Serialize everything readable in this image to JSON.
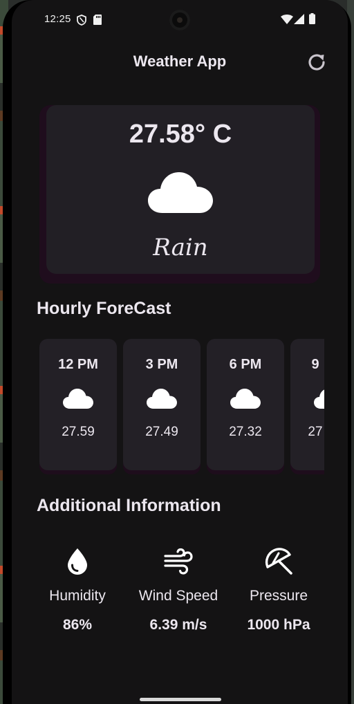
{
  "status_bar": {
    "time": "12:25",
    "icons": [
      "shield-icon",
      "sd-card-icon",
      "wifi-icon",
      "signal-icon",
      "battery-icon"
    ]
  },
  "app": {
    "title": "Weather App",
    "refresh_icon": "refresh-icon"
  },
  "current": {
    "temperature": "27.58° C",
    "condition": "Rain",
    "icon": "cloud-icon"
  },
  "hourly": {
    "heading": "Hourly ForeCast",
    "items": [
      {
        "time": "12 PM",
        "temp": "27.59",
        "icon": "cloud-icon"
      },
      {
        "time": "3 PM",
        "temp": "27.49",
        "icon": "cloud-icon"
      },
      {
        "time": "6 PM",
        "temp": "27.32",
        "icon": "cloud-icon"
      },
      {
        "time": "9",
        "temp": "27",
        "icon": "cloud-icon"
      }
    ]
  },
  "additional": {
    "heading": "Additional Information",
    "items": [
      {
        "label": "Humidity",
        "value": "86%",
        "icon": "water-drop-icon"
      },
      {
        "label": "Wind Speed",
        "value": "6.39 m/s",
        "icon": "wind-icon"
      },
      {
        "label": "Pressure",
        "value": "1000 hPa",
        "icon": "beach-umbrella-icon"
      }
    ]
  },
  "colors": {
    "background": "#141314",
    "card": "#232026",
    "card_shadow": "#1f0d1d",
    "text": "#ece7ef"
  }
}
